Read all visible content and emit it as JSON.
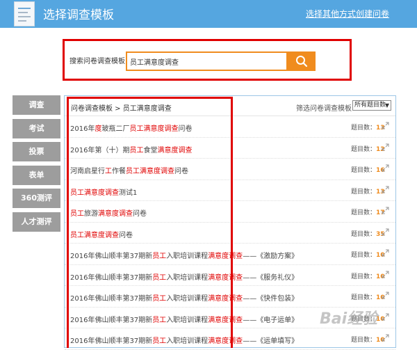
{
  "header": {
    "title": "选择调查模板",
    "link": "选择其他方式创建问卷"
  },
  "search": {
    "label": "搜索问卷调查模板：",
    "value": "员工满意度调查"
  },
  "side_nav": [
    {
      "label": "调查"
    },
    {
      "label": "考试"
    },
    {
      "label": "投票"
    },
    {
      "label": "表单"
    },
    {
      "label": "360测评"
    },
    {
      "label": "人才测评"
    }
  ],
  "panel": {
    "breadcrumb": "问卷调查模板 > 员工满意度调查",
    "filter_label": "筛选问卷调查模板：",
    "filter_value": "所有题目数",
    "count_label": "题目数：",
    "rows": [
      {
        "parts": [
          {
            "t": "2016年"
          },
          {
            "t": "度",
            "hl": true
          },
          {
            "t": "玻瓶二厂"
          },
          {
            "t": "员工满意度调查",
            "hl": true
          },
          {
            "t": "问卷"
          }
        ],
        "count": "13"
      },
      {
        "parts": [
          {
            "t": "2016年第（十）期"
          },
          {
            "t": "员工",
            "hl": true
          },
          {
            "t": "食堂"
          },
          {
            "t": "满意度调查",
            "hl": true
          }
        ],
        "count": "12"
      },
      {
        "parts": [
          {
            "t": "河南启星行"
          },
          {
            "t": "工",
            "hl": true
          },
          {
            "t": "作餐"
          },
          {
            "t": "员工满意度调查",
            "hl": true
          },
          {
            "t": "问卷"
          }
        ],
        "count": "16"
      },
      {
        "parts": [
          {
            "t": "员工满意度调查",
            "hl": true
          },
          {
            "t": "测试1"
          }
        ],
        "count": "13"
      },
      {
        "parts": [
          {
            "t": "员工",
            "hl": true
          },
          {
            "t": "旅游"
          },
          {
            "t": "满意度调查",
            "hl": true
          },
          {
            "t": "问卷"
          }
        ],
        "count": "17"
      },
      {
        "parts": [
          {
            "t": "员工满意度调查",
            "hl": true
          },
          {
            "t": "问卷"
          }
        ],
        "count": "35"
      },
      {
        "parts": [
          {
            "t": "2016年佛山顺丰第37期新"
          },
          {
            "t": "员工",
            "hl": true
          },
          {
            "t": "入职培训课程"
          },
          {
            "t": "满意度调查",
            "hl": true
          },
          {
            "t": "——《激励方案》"
          }
        ],
        "count": "10"
      },
      {
        "parts": [
          {
            "t": "2016年佛山顺丰第37期新"
          },
          {
            "t": "员工",
            "hl": true
          },
          {
            "t": "入职培训课程"
          },
          {
            "t": "满意度调查",
            "hl": true
          },
          {
            "t": "——《服务礼仪》"
          }
        ],
        "count": "10"
      },
      {
        "parts": [
          {
            "t": "2016年佛山顺丰第37期新"
          },
          {
            "t": "员工",
            "hl": true
          },
          {
            "t": "入职培训课程"
          },
          {
            "t": "满意度调查",
            "hl": true
          },
          {
            "t": "——《快件包装》"
          }
        ],
        "count": "10"
      },
      {
        "parts": [
          {
            "t": "2016年佛山顺丰第37期新"
          },
          {
            "t": "员工",
            "hl": true
          },
          {
            "t": "入职培训课程"
          },
          {
            "t": "满意度调查",
            "hl": true
          },
          {
            "t": "——《电子运单》"
          }
        ],
        "count": "10"
      },
      {
        "parts": [
          {
            "t": "2016年佛山顺丰第37期新"
          },
          {
            "t": "员工",
            "hl": true
          },
          {
            "t": "入职培训课程"
          },
          {
            "t": "满意度调查",
            "hl": true
          },
          {
            "t": "——《运单填写》"
          }
        ],
        "count": "10"
      }
    ]
  },
  "watermark": "Bai经验",
  "colors": {
    "header_bg": "#55a6e0",
    "accent_orange": "#f08c1e",
    "highlight_red": "#e00000",
    "nav_gray": "#9d9d9d"
  }
}
